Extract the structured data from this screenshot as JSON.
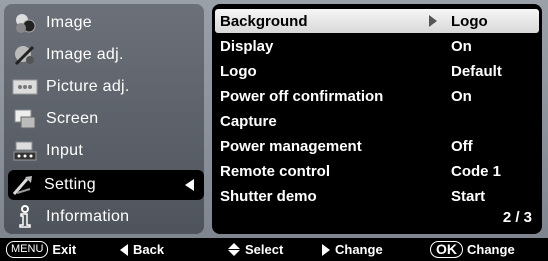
{
  "left_menu": {
    "items": [
      {
        "label": "Image",
        "icon": "image-icon"
      },
      {
        "label": "Image adj.",
        "icon": "image-adj-icon"
      },
      {
        "label": "Picture adj.",
        "icon": "picture-adj-icon"
      },
      {
        "label": "Screen",
        "icon": "screen-icon"
      },
      {
        "label": "Input",
        "icon": "input-icon"
      },
      {
        "label": "Setting",
        "icon": "setting-icon"
      },
      {
        "label": "Information",
        "icon": "information-icon"
      }
    ],
    "selected": "Setting"
  },
  "settings": {
    "rows": [
      {
        "label": "Background",
        "value": "Logo"
      },
      {
        "label": "Display",
        "value": "On"
      },
      {
        "label": "Logo",
        "value": "Default"
      },
      {
        "label": "Power off confirmation",
        "value": "On"
      },
      {
        "label": "Capture",
        "value": ""
      },
      {
        "label": "Power management",
        "value": "Off"
      },
      {
        "label": "Remote control",
        "value": "Code 1"
      },
      {
        "label": "Shutter demo",
        "value": "Start"
      }
    ],
    "highlighted": "Background",
    "page": "2 / 3"
  },
  "bottom_bar": {
    "menu_key": "MENU",
    "exit": "Exit",
    "back": "Back",
    "select": "Select",
    "change": "Change",
    "ok_key": "OK",
    "ok_change": "Change"
  },
  "colors": {
    "background": "#8a9099",
    "panel": "#000000",
    "highlight": "#e8e8e8",
    "text": "#ffffff"
  }
}
